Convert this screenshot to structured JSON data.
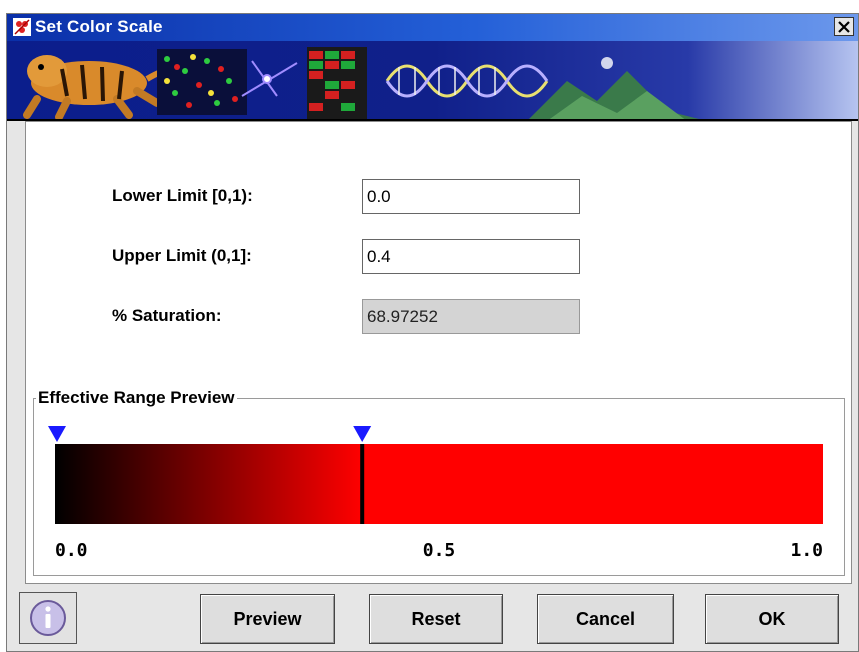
{
  "window": {
    "title": "Set Color Scale"
  },
  "form": {
    "lower_limit": {
      "label": "Lower Limit [0,1):",
      "value": "0.0"
    },
    "upper_limit": {
      "label": "Upper Limit (0,1]:",
      "value": "0.4"
    },
    "saturation": {
      "label": "% Saturation:",
      "value": "68.97252"
    }
  },
  "range_preview": {
    "legend": "Effective Range Preview",
    "axis_labels": [
      "0.0",
      "0.5",
      "1.0"
    ],
    "lower_marker": 0.0,
    "upper_marker": 0.4,
    "gradient_start_color": "#000000",
    "gradient_end_color": "#ff0000",
    "marker_color": "#1a1aff"
  },
  "buttons": {
    "info_icon": "info-icon",
    "preview": "Preview",
    "reset": "Reset",
    "cancel": "Cancel",
    "ok": "OK"
  }
}
